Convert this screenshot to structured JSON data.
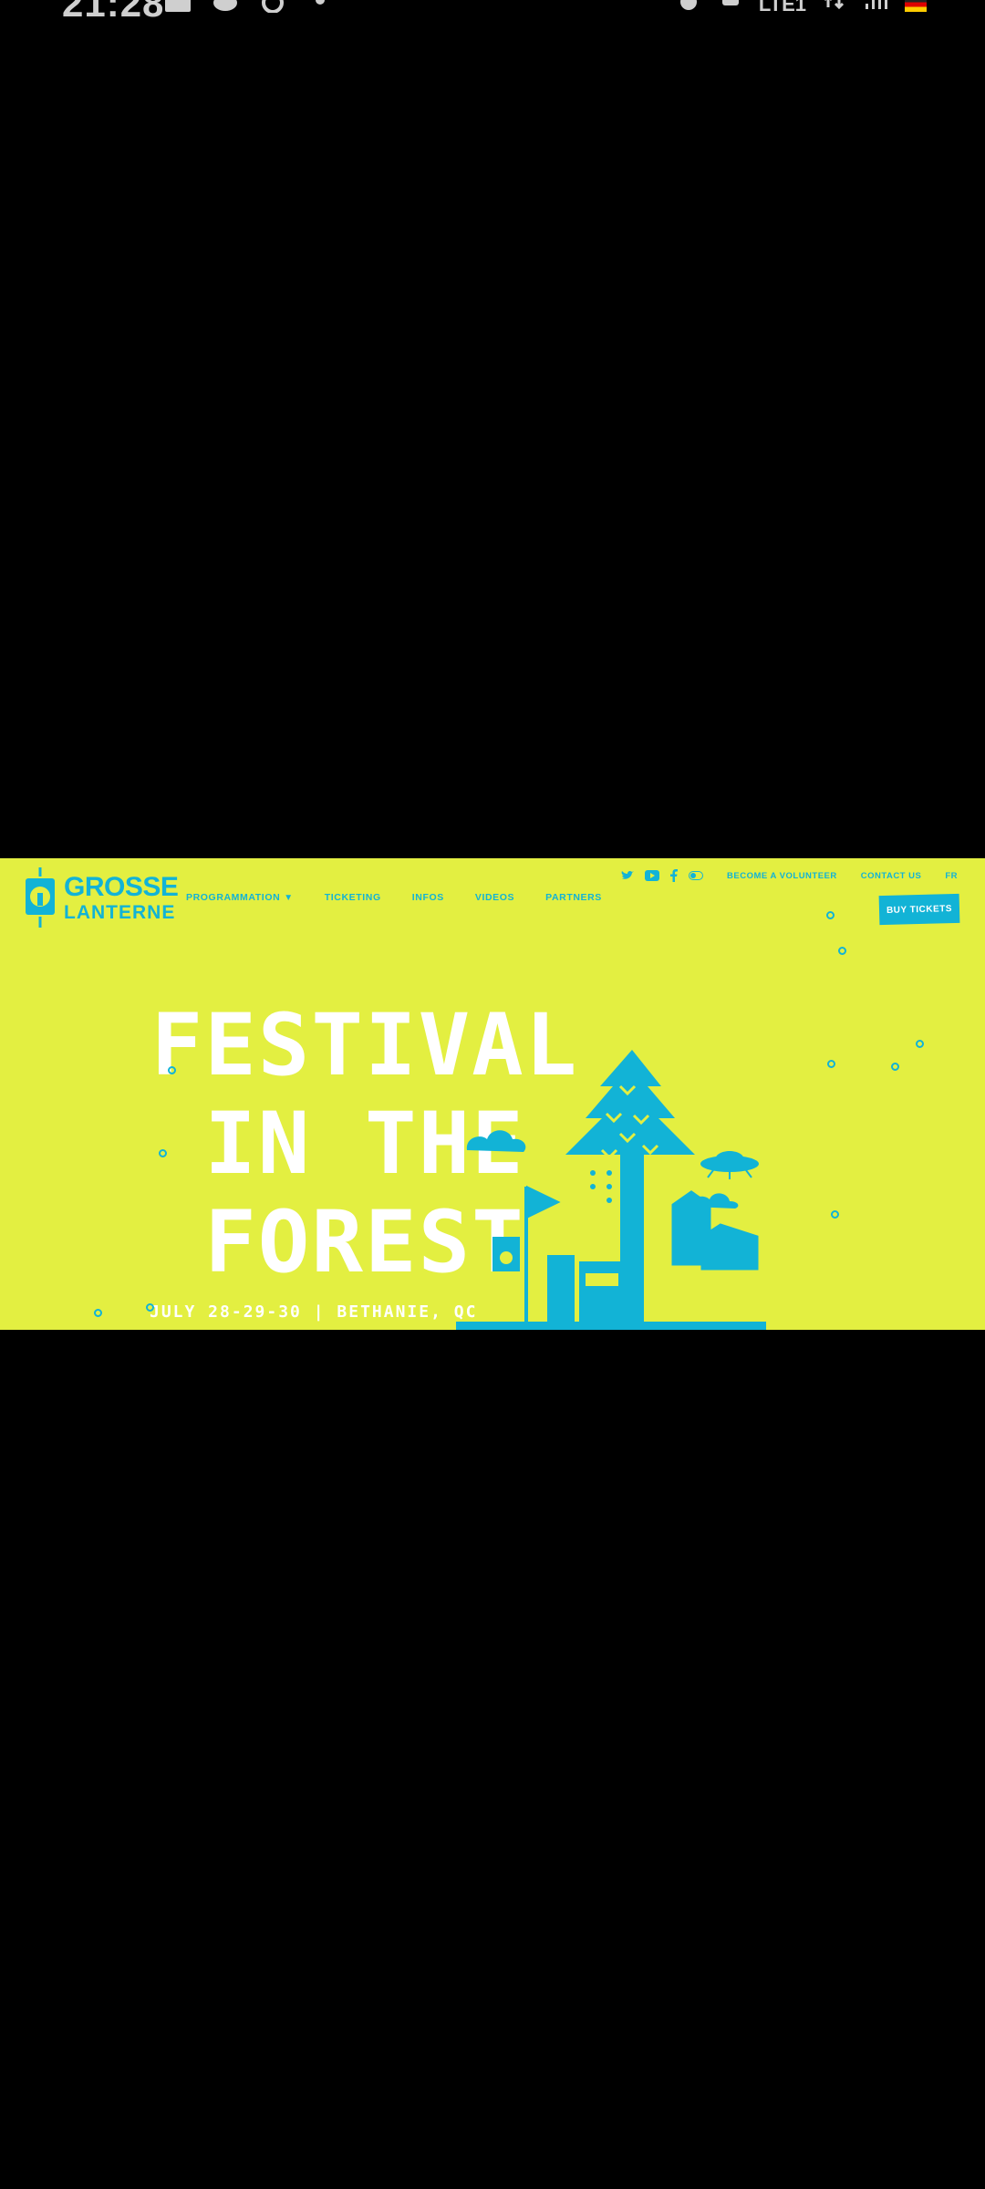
{
  "status_bar": {
    "time": "21:28",
    "network": "LTE1"
  },
  "site": {
    "logo": {
      "line1": "GROSSE",
      "line2": "LANTERNE"
    },
    "nav": [
      {
        "label": "PROGRAMMATION"
      },
      {
        "label": "TICKETING"
      },
      {
        "label": "INFOS"
      },
      {
        "label": "VIDEOS"
      },
      {
        "label": "PARTNERS"
      }
    ],
    "top_links": {
      "volunteer": "BECOME A VOLUNTEER",
      "contact": "CONTACT US",
      "lang": "FR"
    },
    "buy_label": "BUY TICKETS",
    "hero": {
      "line1": "FESTIVAL",
      "line2": "IN THE",
      "line3": "FOREST",
      "dates": "JULY 28-29-30 | BETHANIE, QC"
    },
    "colors": {
      "background": "#e3ef41",
      "accent": "#12b3d6",
      "text": "#ffffff"
    },
    "socials": [
      "twitter-icon",
      "youtube-icon",
      "facebook-icon",
      "toggle-icon"
    ]
  }
}
